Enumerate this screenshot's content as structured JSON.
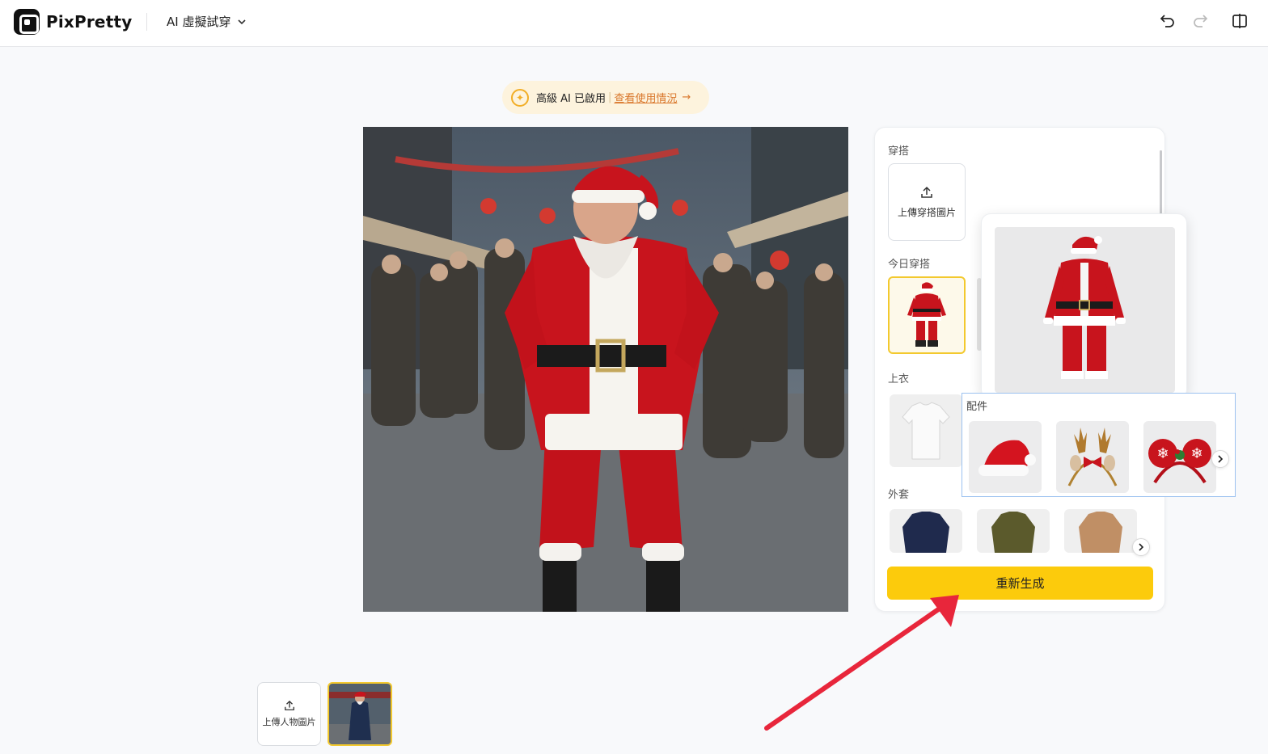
{
  "app": {
    "name": "PixPretty"
  },
  "header": {
    "tool_label": "AI 虛擬試穿"
  },
  "ai_banner": {
    "status": "高級 AI 已啟用",
    "separator": "|",
    "link": "查看使用情況",
    "arrow": "→"
  },
  "panel": {
    "outfit_label": "穿搭",
    "upload_outfit_label": "上傳穿搭圖片",
    "today_label": "今日穿搭",
    "tops_label": "上衣",
    "outerwear_label": "外套",
    "regenerate_label": "重新生成"
  },
  "accessories": {
    "label": "配件",
    "items": [
      "santa-hat",
      "reindeer-antler-headband",
      "christmas-ear-headband"
    ]
  },
  "bottom": {
    "upload_person_label": "上傳人物圖片"
  },
  "colors": {
    "accent": "#fccb0c",
    "selected_border": "#f3c92e",
    "annotation_arrow": "#e8263b",
    "link": "#d9772b"
  }
}
